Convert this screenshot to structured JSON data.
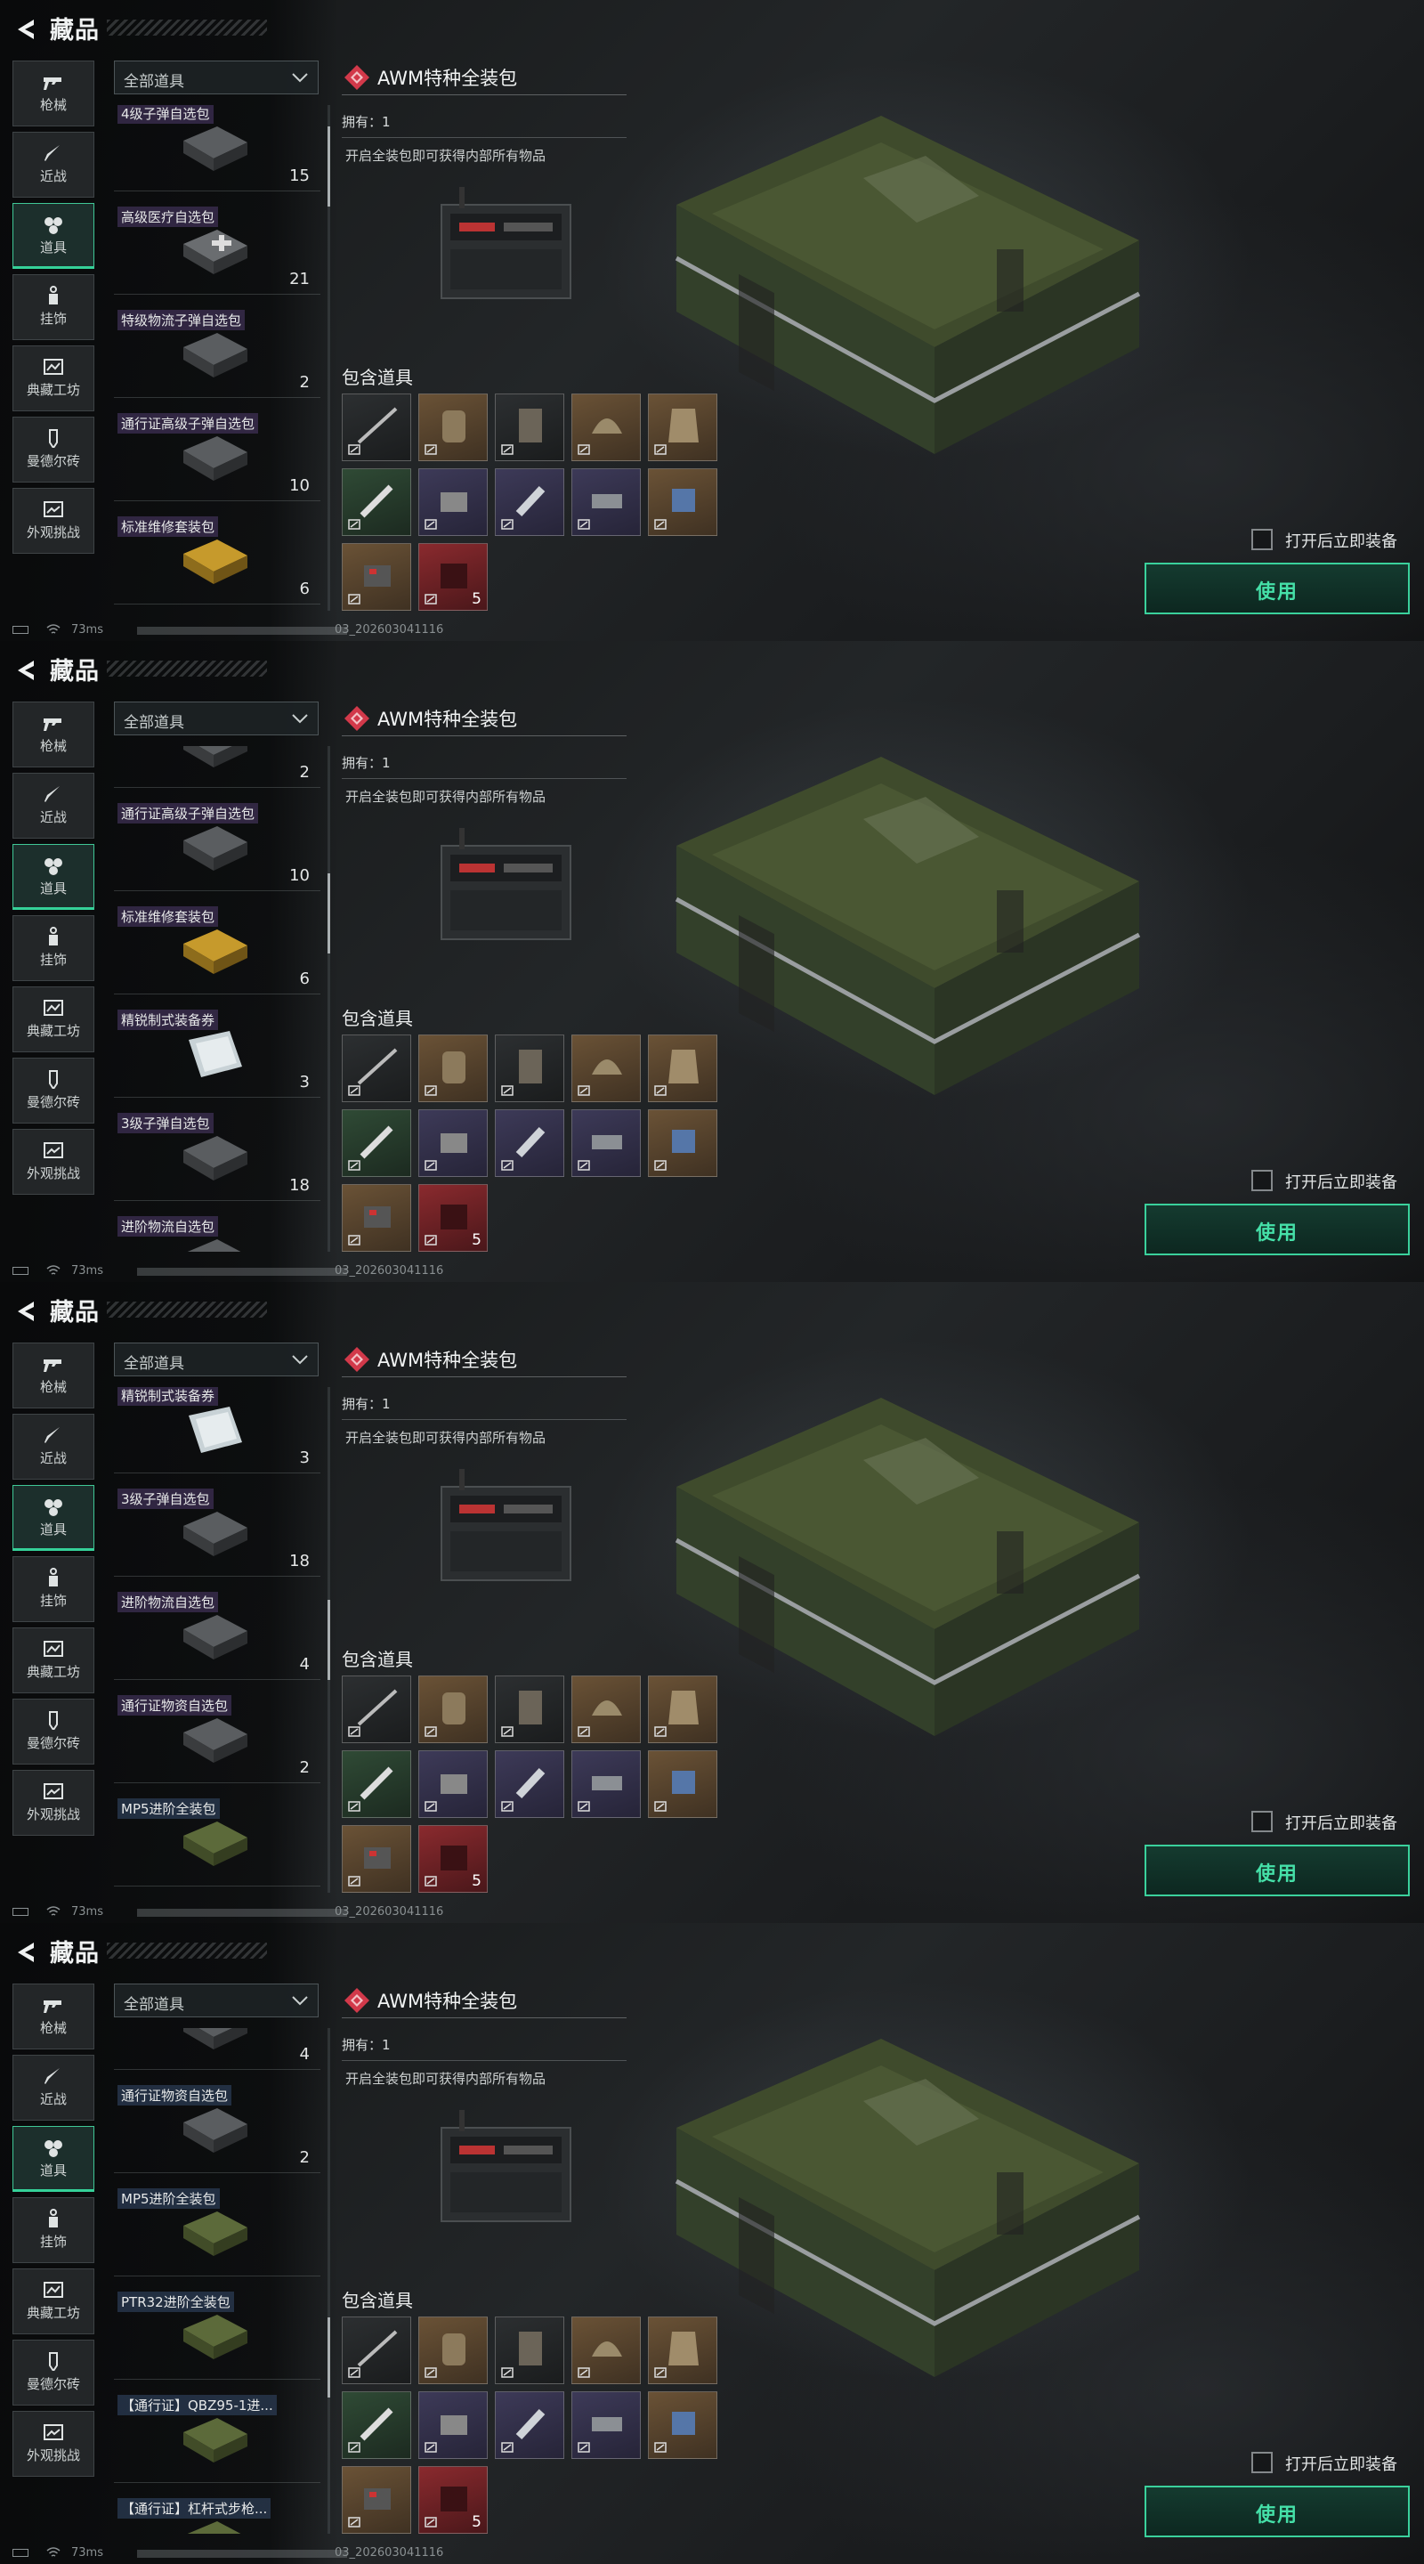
{
  "header": {
    "title": "藏品"
  },
  "categories": [
    {
      "label": "枪械",
      "icon": "gun-icon"
    },
    {
      "label": "近战",
      "icon": "knife-icon"
    },
    {
      "label": "道具",
      "icon": "props-icon"
    },
    {
      "label": "挂饰",
      "icon": "charm-icon"
    },
    {
      "label": "典藏工坊",
      "icon": "workshop-icon"
    },
    {
      "label": "曼德尔砖",
      "icon": "brick-icon"
    },
    {
      "label": "外观挑战",
      "icon": "challenge-icon"
    }
  ],
  "active_category": "道具",
  "filter": {
    "selected": "全部道具"
  },
  "detail": {
    "title": "AWM特种全装包",
    "owned": "拥有：1",
    "description": "开启全装包即可获得内部所有物品",
    "contains_label": "包含道具",
    "contents": [
      {
        "icon": "rifle-icon",
        "tone": "dark",
        "count": ""
      },
      {
        "icon": "backpack-icon",
        "tone": "brown",
        "count": ""
      },
      {
        "icon": "vest-icon",
        "tone": "dark",
        "count": ""
      },
      {
        "icon": "helmet-icon",
        "tone": "brown",
        "count": ""
      },
      {
        "icon": "armor-icon",
        "tone": "brown",
        "count": ""
      },
      {
        "icon": "syringe-icon",
        "tone": "green",
        "count": ""
      },
      {
        "icon": "medkit-icon",
        "tone": "purple",
        "count": ""
      },
      {
        "icon": "injector-icon",
        "tone": "purple",
        "count": ""
      },
      {
        "icon": "magazine-icon",
        "tone": "purple",
        "count": ""
      },
      {
        "icon": "battery-icon",
        "tone": "brown",
        "count": ""
      },
      {
        "icon": "ammo-box-icon",
        "tone": "brown",
        "count": ""
      },
      {
        "icon": "ammo-pack-icon",
        "tone": "red",
        "count": "5"
      }
    ]
  },
  "actions": {
    "auto_equip_label": "打开后立即装备",
    "use_label": "使用"
  },
  "status": {
    "ping": "73ms",
    "version": "03_202603041116"
  },
  "frames": [
    {
      "scroll_thumb": 0.05,
      "items": [
        {
          "name": "4级子弹自选包",
          "count": "15",
          "tag": "purple",
          "thumb": "case"
        },
        {
          "name": "高级医疗自选包",
          "count": "21",
          "tag": "purple",
          "thumb": "med"
        },
        {
          "name": "特级物流子弹自选包",
          "count": "2",
          "tag": "purple",
          "thumb": "case"
        },
        {
          "name": "通行证高级子弹自选包",
          "count": "10",
          "tag": "purple",
          "thumb": "case"
        },
        {
          "name": "标准维修套装包",
          "count": "6",
          "tag": "purple",
          "thumb": "gold"
        }
      ]
    },
    {
      "scroll_thumb": 0.3,
      "items": [
        {
          "name": "",
          "count": "2",
          "tag": "purple",
          "thumb": "case"
        },
        {
          "name": "通行证高级子弹自选包",
          "count": "10",
          "tag": "purple",
          "thumb": "case"
        },
        {
          "name": "标准维修套装包",
          "count": "6",
          "tag": "purple",
          "thumb": "gold"
        },
        {
          "name": "精锐制式装备券",
          "count": "3",
          "tag": "purple",
          "thumb": "ticket"
        },
        {
          "name": "3级子弹自选包",
          "count": "18",
          "tag": "purple",
          "thumb": "case"
        },
        {
          "name": "进阶物流自选包",
          "count": "",
          "tag": "purple",
          "thumb": "case"
        }
      ]
    },
    {
      "scroll_thumb": 0.5,
      "items": [
        {
          "name": "精锐制式装备券",
          "count": "3",
          "tag": "purple",
          "thumb": "ticket"
        },
        {
          "name": "3级子弹自选包",
          "count": "18",
          "tag": "purple",
          "thumb": "case"
        },
        {
          "name": "进阶物流自选包",
          "count": "4",
          "tag": "purple",
          "thumb": "case"
        },
        {
          "name": "通行证物资自选包",
          "count": "2",
          "tag": "purple",
          "thumb": "case"
        },
        {
          "name": "MP5进阶全装包",
          "count": "",
          "tag": "blue",
          "thumb": "green"
        }
      ]
    },
    {
      "scroll_thumb": 0.68,
      "items": [
        {
          "name": "",
          "count": "4",
          "tag": "purple",
          "thumb": "case"
        },
        {
          "name": "通行证物资自选包",
          "count": "2",
          "tag": "blue",
          "thumb": "case"
        },
        {
          "name": "MP5进阶全装包",
          "count": "",
          "tag": "blue",
          "thumb": "green"
        },
        {
          "name": "PTR32进阶全装包",
          "count": "",
          "tag": "blue",
          "thumb": "green"
        },
        {
          "name": "【通行证】QBZ95-1进...",
          "count": "",
          "tag": "blue",
          "thumb": "green"
        },
        {
          "name": "【通行证】杠杆式步枪...",
          "count": "",
          "tag": "blue",
          "thumb": "green"
        }
      ]
    }
  ]
}
